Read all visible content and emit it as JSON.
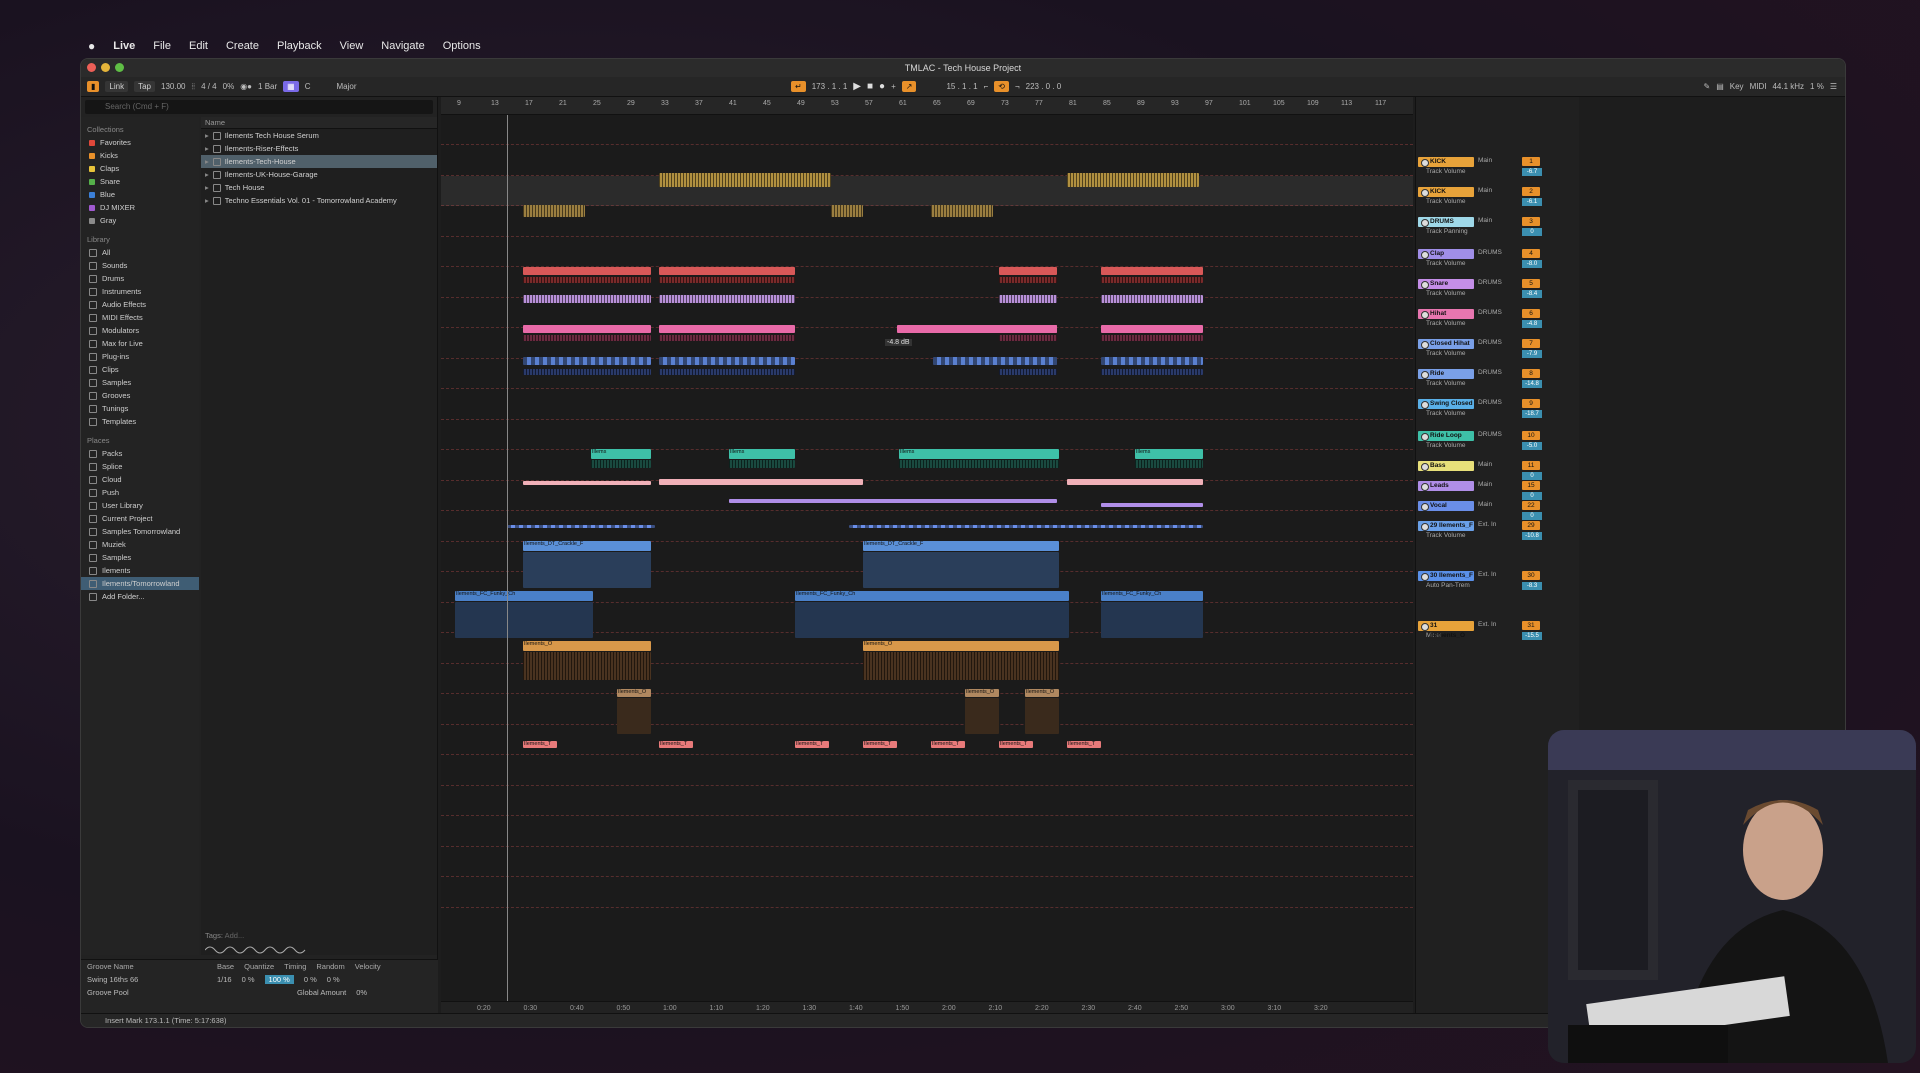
{
  "menubar": {
    "apple": "",
    "items": [
      "Live",
      "File",
      "Edit",
      "Create",
      "Playback",
      "View",
      "Navigate",
      "Options"
    ]
  },
  "window": {
    "title": "TMLAC - Tech House Project"
  },
  "toolbar": {
    "link": "Link",
    "tap": "Tap",
    "tempo": "130.00",
    "time_sig": "4 / 4",
    "percent": "0%",
    "bar": "1 Bar",
    "key": "C",
    "scale": "Major",
    "position": "173 . 1 . 1",
    "loop_start": "15 . 1 . 1",
    "loop_length": "223 . 0 . 0",
    "key_label": "Key",
    "midi_label": "MIDI",
    "sample_rate": "44.1 kHz",
    "cpu": "1 %"
  },
  "browser": {
    "search_placeholder": "Search (Cmd + F)",
    "collections_title": "Collections",
    "collections": [
      {
        "label": "Favorites",
        "color": "#e0483a"
      },
      {
        "label": "Kicks",
        "color": "#e8902a"
      },
      {
        "label": "Claps",
        "color": "#e8c43a"
      },
      {
        "label": "Snare",
        "color": "#55b14a"
      },
      {
        "label": "Blue",
        "color": "#3b7fd6"
      },
      {
        "label": "DJ MIXER",
        "color": "#a05ad0"
      },
      {
        "label": "Gray",
        "color": "#8a8a8a"
      }
    ],
    "library_title": "Library",
    "library": [
      "All",
      "Sounds",
      "Drums",
      "Instruments",
      "Audio Effects",
      "MIDI Effects",
      "Modulators",
      "Max for Live",
      "Plug-ins",
      "Clips",
      "Samples",
      "Grooves",
      "Tunings",
      "Templates"
    ],
    "places_title": "Places",
    "places": [
      "Packs",
      "Splice",
      "Cloud",
      "Push",
      "User Library",
      "Current Project",
      "Samples Tomorrowland",
      "Muziek",
      "Samples",
      "Ilements",
      "Ilements/Tomorrowland",
      "Add Folder..."
    ],
    "selected_place": "Ilements/Tomorrowland",
    "name_header": "Name",
    "files": [
      "Ilements Tech House Serum",
      "Ilements-Riser-Effects",
      "Ilements-Tech-House",
      "Ilements-UK-House-Garage",
      "Tech House",
      "Techno Essentials Vol. 01 - Tomorrowland Academy"
    ],
    "selected_file": "Ilements-Tech-House",
    "tags_label": "Tags:",
    "tags_add": "Add..."
  },
  "groove": {
    "headers": [
      "Groove Name",
      "Base",
      "Quantize",
      "Timing",
      "Random",
      "Velocity"
    ],
    "row": {
      "name": "Swing 16ths 66",
      "base": "1/16",
      "quantize": "0 %",
      "timing": "100 %",
      "random": "0 %",
      "velocity": "0 %"
    },
    "pool_label": "Groove Pool",
    "global_amount_label": "Global Amount",
    "global_amount": "0%"
  },
  "ruler": {
    "bars": [
      "9",
      "13",
      "17",
      "21",
      "25",
      "29",
      "33",
      "37",
      "41",
      "45",
      "49",
      "53",
      "57",
      "61",
      "65",
      "69",
      "73",
      "77",
      "81",
      "85",
      "89",
      "93",
      "97",
      "101",
      "105",
      "109",
      "113",
      "117"
    ],
    "times": [
      "0:20",
      "0:30",
      "0:40",
      "0:50",
      "1:00",
      "1:10",
      "1:20",
      "1:30",
      "1:40",
      "1:50",
      "2:00",
      "2:10",
      "2:20",
      "2:30",
      "2:40",
      "2:50",
      "3:00",
      "3:10",
      "3:20"
    ]
  },
  "tooltip": "-4.8 dB",
  "clip_labels": {
    "ride_loop": "Illems",
    "crackle": "Ilements_DT_Crackle_F",
    "funky": "Ilements_FC_Funky_Ch",
    "orange": "Ilements_O",
    "small_red": "Ilements_T"
  },
  "tracks": [
    {
      "name": "KICK",
      "color": "#e8a33a",
      "num": "1",
      "vol": "-6.7",
      "out": "Main",
      "sub": "Track Volume"
    },
    {
      "name": "KICK",
      "color": "#e8a33a",
      "num": "2",
      "vol": "-6.1",
      "out": "Main",
      "sub": "Track Volume"
    },
    {
      "name": "DRUMS",
      "color": "#9fd8e8",
      "num": "3",
      "vol": "0",
      "out": "Main",
      "sub": "Track Panning"
    },
    {
      "name": "Clap",
      "color": "#a08ee8",
      "num": "4",
      "vol": "-8.0",
      "out": "DRUMS",
      "sub": "Track Volume"
    },
    {
      "name": "Snare",
      "color": "#c48ee8",
      "num": "5",
      "vol": "-8.4",
      "out": "DRUMS",
      "sub": "Track Volume"
    },
    {
      "name": "Hihat",
      "color": "#e876b0",
      "num": "6",
      "vol": "-4.8",
      "out": "DRUMS",
      "sub": "Track Volume"
    },
    {
      "name": "Closed Hihat",
      "color": "#7aa0e8",
      "num": "7",
      "vol": "-7.9",
      "out": "DRUMS",
      "sub": "Track Volume"
    },
    {
      "name": "Ride",
      "color": "#7aa0e8",
      "num": "8",
      "vol": "-14.8",
      "out": "DRUMS",
      "sub": "Track Volume"
    },
    {
      "name": "Swing Closed",
      "color": "#5ab0e8",
      "num": "9",
      "vol": "-18.7",
      "out": "DRUMS",
      "sub": "Track Volume"
    },
    {
      "name": "Ride Loop",
      "color": "#3ec0a8",
      "num": "10",
      "vol": "-5.0",
      "out": "DRUMS",
      "sub": "Track Volume"
    },
    {
      "name": "Bass",
      "color": "#e8e07a",
      "num": "11",
      "vol": "0",
      "out": "Main",
      "sub": ""
    },
    {
      "name": "Leads",
      "color": "#b08ee8",
      "num": "15",
      "vol": "0",
      "out": "Main",
      "sub": ""
    },
    {
      "name": "Vocal",
      "color": "#6a8ee8",
      "num": "22",
      "vol": "0",
      "out": "Main",
      "sub": ""
    },
    {
      "name": "29 Ilements_F",
      "color": "#6aa0e8",
      "num": "29",
      "vol": "-10.8",
      "out": "Ext. In",
      "sub": "Track Volume"
    },
    {
      "name": "30 Ilements_F",
      "color": "#5a90e8",
      "num": "30",
      "vol": "-8.3",
      "out": "Ext. In",
      "sub": "Auto Pan-Trem"
    },
    {
      "name": "31 Ilements_O",
      "color": "#e8a33a",
      "num": "31",
      "vol": "-15.5",
      "out": "Ext. In",
      "sub": "Mixer"
    }
  ],
  "status": {
    "text": "Insert Mark 173.1.1 (Time: 5:17:638)"
  }
}
